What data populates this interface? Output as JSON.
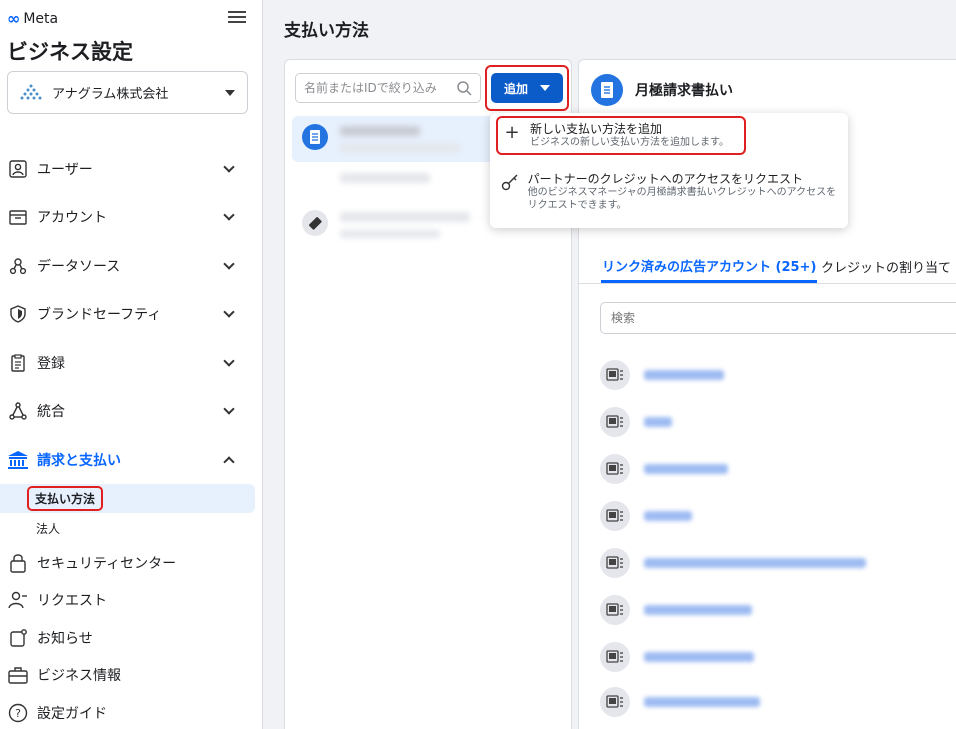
{
  "brand": {
    "logo_text": "Meta",
    "accent": "#0866ff"
  },
  "app": {
    "title": "ビジネス設定"
  },
  "business": {
    "name": "アナグラム株式会社"
  },
  "sidebar": {
    "items": [
      {
        "label": "ユーザー",
        "icon": "users-icon"
      },
      {
        "label": "アカウント",
        "icon": "accounts-icon"
      },
      {
        "label": "データソース",
        "icon": "data-sources-icon"
      },
      {
        "label": "ブランドセーフティ",
        "icon": "shield-icon"
      },
      {
        "label": "登録",
        "icon": "clipboard-icon"
      },
      {
        "label": "統合",
        "icon": "integrations-icon"
      },
      {
        "label": "請求と支払い",
        "icon": "bank-icon"
      }
    ],
    "billing_sub": [
      "支払い方法",
      "法人"
    ],
    "bottom_items": [
      {
        "label": "セキュリティセンター",
        "icon": "lock-icon"
      },
      {
        "label": "リクエスト",
        "icon": "person-request-icon"
      },
      {
        "label": "お知らせ",
        "icon": "notification-icon"
      },
      {
        "label": "ビジネス情報",
        "icon": "briefcase-icon"
      },
      {
        "label": "設定ガイド",
        "icon": "help-icon"
      }
    ]
  },
  "main": {
    "page_title": "支払い方法",
    "search_placeholder": "名前またはIDで絞り込み",
    "add_button": "追加"
  },
  "dropdown": {
    "items": [
      {
        "title": "新しい支払い方法を追加",
        "desc": "ビジネスの新しい支払い方法を追加します。"
      },
      {
        "title": "パートナーのクレジットへのアクセスをリクエスト",
        "desc": "他のビジネスマネージャの月極請求書払いクレジットへのアクセスをリクエストできます。"
      }
    ]
  },
  "detail": {
    "title": "月極請求書払い",
    "tabs": [
      "リンク済みの広告アカウント (25+)",
      "クレジットの割り当て"
    ],
    "search_placeholder": "検索"
  }
}
